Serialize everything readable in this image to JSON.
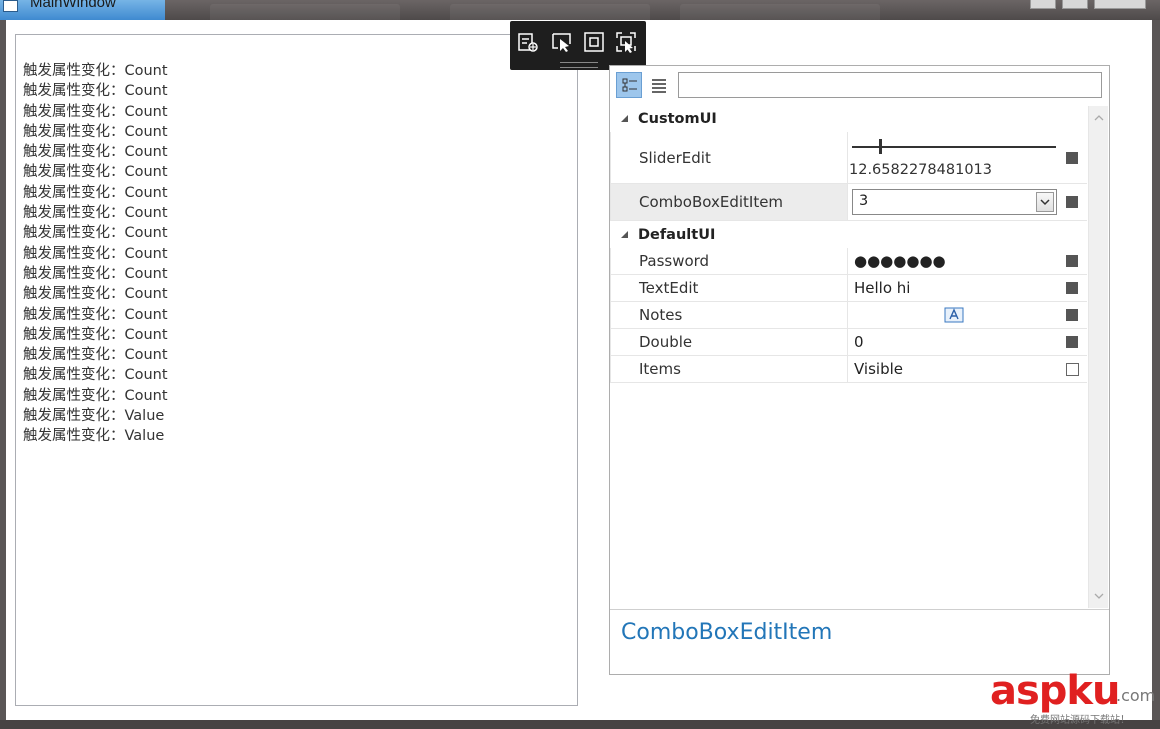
{
  "window": {
    "title": "MainWindow"
  },
  "log": {
    "items": [
      "触发属性变化：Count",
      "触发属性变化：Count",
      "触发属性变化：Count",
      "触发属性变化：Count",
      "触发属性变化：Count",
      "触发属性变化：Count",
      "触发属性变化：Count",
      "触发属性变化：Count",
      "触发属性变化：Count",
      "触发属性变化：Count",
      "触发属性变化：Count",
      "触发属性变化：Count",
      "触发属性变化：Count",
      "触发属性变化：Count",
      "触发属性变化：Count",
      "触发属性变化：Count",
      "触发属性变化：Count",
      "触发属性变化：Value",
      "触发属性变化：Value"
    ]
  },
  "toolbar": {
    "icons": [
      "go-to-live-tree-icon",
      "select-element-icon",
      "display-layout-adorners-icon",
      "track-focused-element-icon"
    ]
  },
  "property_grid": {
    "mode_icons": [
      "categorized-icon",
      "alphabetical-icon"
    ],
    "search_value": "",
    "categories": [
      {
        "label": "CustomUI",
        "properties": [
          {
            "name": "SliderEdit",
            "value": "12.6582278481013",
            "slider_fraction": 0.13
          },
          {
            "name": "ComboBoxEditItem",
            "value": "3",
            "selected": true
          }
        ]
      },
      {
        "label": "DefaultUI",
        "properties": [
          {
            "name": "Password",
            "value": "●●●●●●●"
          },
          {
            "name": "TextEdit",
            "value": "Hello hi"
          },
          {
            "name": "Notes",
            "value": ""
          },
          {
            "name": "Double",
            "value": "0"
          },
          {
            "name": "Items",
            "value": "Visible",
            "marker": "empty"
          }
        ]
      }
    ],
    "description": "ComboBoxEditItem"
  },
  "watermark": {
    "main": "aspku",
    "suffix": ".com",
    "sub": "免费网站源码下载站！"
  },
  "colors": {
    "accent": "#2276b8",
    "selection": "#9dc6ec",
    "watermark": "#e02020"
  }
}
